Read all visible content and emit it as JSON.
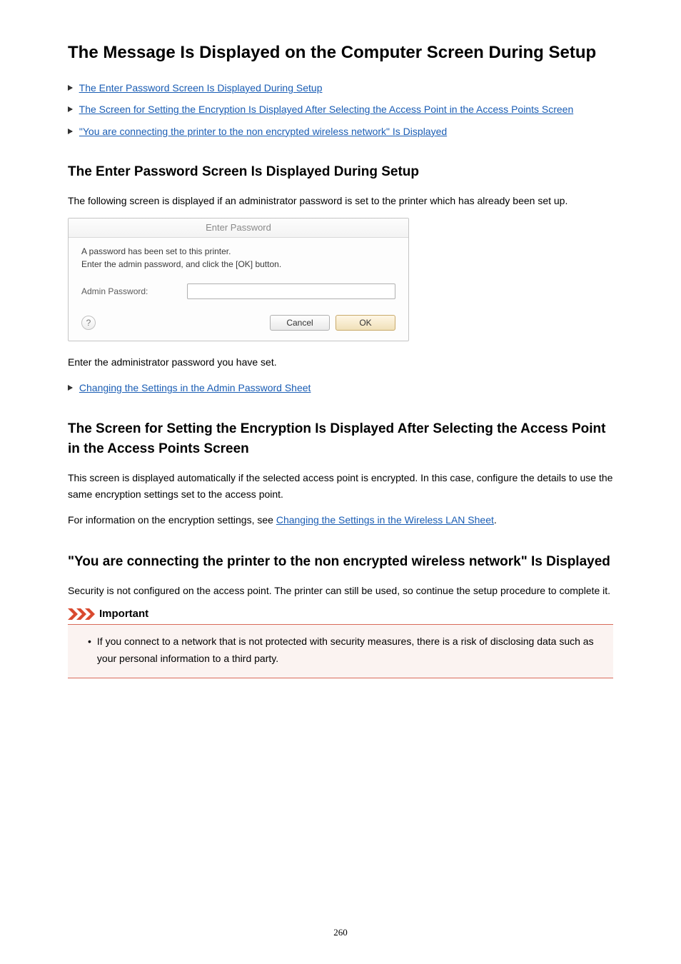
{
  "title": "The Message Is Displayed on the Computer Screen During Setup",
  "links": {
    "link1": "The Enter Password Screen Is Displayed During Setup",
    "link2": "The Screen for Setting the Encryption Is Displayed After Selecting the Access Point in the Access Points Screen",
    "link3": "\"You are connecting the printer to the non encrypted wireless network\" Is Displayed"
  },
  "section1": {
    "heading": "The Enter Password Screen Is Displayed During Setup",
    "p1": "The following screen is displayed if an administrator password is set to the printer which has already been set up.",
    "dialog": {
      "title": "Enter Password",
      "line1": "A password has been set to this printer.",
      "line2": "Enter the admin password, and click the [OK] button.",
      "label": "Admin Password:",
      "help": "?",
      "cancel": "Cancel",
      "ok": "OK"
    },
    "p2": "Enter the administrator password you have set.",
    "link": "Changing the Settings in the Admin Password Sheet"
  },
  "section2": {
    "heading": "The Screen for Setting the Encryption Is Displayed After Selecting the Access Point in the Access Points Screen",
    "p1": "This screen is displayed automatically if the selected access point is encrypted. In this case, configure the details to use the same encryption settings set to the access point.",
    "p2a": "For information on the encryption settings, see ",
    "p2link": "Changing the Settings in the Wireless LAN Sheet",
    "p2b": "."
  },
  "section3": {
    "heading": "\"You are connecting the printer to the non encrypted wireless network\" Is Displayed",
    "p1": "Security is not configured on the access point. The printer can still be used, so continue the setup procedure to complete it.",
    "important_label": "Important",
    "important_text": "If you connect to a network that is not protected with security measures, there is a risk of disclosing data such as your personal information to a third party."
  },
  "page_number": "260"
}
